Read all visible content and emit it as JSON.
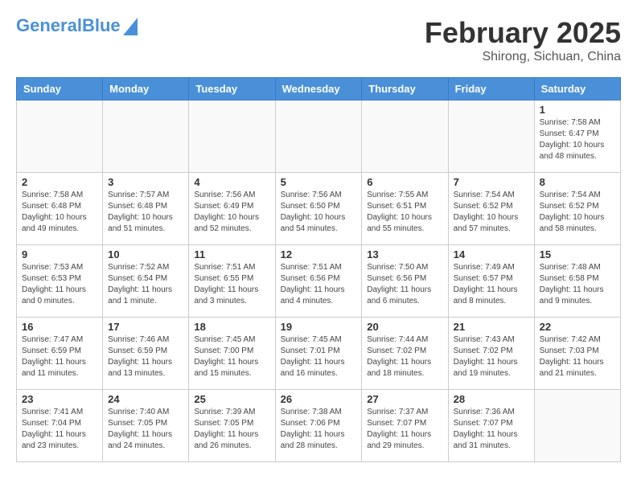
{
  "header": {
    "logo_line1": "General",
    "logo_line2": "Blue",
    "month_year": "February 2025",
    "location": "Shirong, Sichuan, China"
  },
  "weekdays": [
    "Sunday",
    "Monday",
    "Tuesday",
    "Wednesday",
    "Thursday",
    "Friday",
    "Saturday"
  ],
  "weeks": [
    [
      {
        "day": "",
        "info": ""
      },
      {
        "day": "",
        "info": ""
      },
      {
        "day": "",
        "info": ""
      },
      {
        "day": "",
        "info": ""
      },
      {
        "day": "",
        "info": ""
      },
      {
        "day": "",
        "info": ""
      },
      {
        "day": "1",
        "info": "Sunrise: 7:58 AM\nSunset: 6:47 PM\nDaylight: 10 hours\nand 48 minutes."
      }
    ],
    [
      {
        "day": "2",
        "info": "Sunrise: 7:58 AM\nSunset: 6:48 PM\nDaylight: 10 hours\nand 49 minutes."
      },
      {
        "day": "3",
        "info": "Sunrise: 7:57 AM\nSunset: 6:48 PM\nDaylight: 10 hours\nand 51 minutes."
      },
      {
        "day": "4",
        "info": "Sunrise: 7:56 AM\nSunset: 6:49 PM\nDaylight: 10 hours\nand 52 minutes."
      },
      {
        "day": "5",
        "info": "Sunrise: 7:56 AM\nSunset: 6:50 PM\nDaylight: 10 hours\nand 54 minutes."
      },
      {
        "day": "6",
        "info": "Sunrise: 7:55 AM\nSunset: 6:51 PM\nDaylight: 10 hours\nand 55 minutes."
      },
      {
        "day": "7",
        "info": "Sunrise: 7:54 AM\nSunset: 6:52 PM\nDaylight: 10 hours\nand 57 minutes."
      },
      {
        "day": "8",
        "info": "Sunrise: 7:54 AM\nSunset: 6:52 PM\nDaylight: 10 hours\nand 58 minutes."
      }
    ],
    [
      {
        "day": "9",
        "info": "Sunrise: 7:53 AM\nSunset: 6:53 PM\nDaylight: 11 hours\nand 0 minutes."
      },
      {
        "day": "10",
        "info": "Sunrise: 7:52 AM\nSunset: 6:54 PM\nDaylight: 11 hours\nand 1 minute."
      },
      {
        "day": "11",
        "info": "Sunrise: 7:51 AM\nSunset: 6:55 PM\nDaylight: 11 hours\nand 3 minutes."
      },
      {
        "day": "12",
        "info": "Sunrise: 7:51 AM\nSunset: 6:56 PM\nDaylight: 11 hours\nand 4 minutes."
      },
      {
        "day": "13",
        "info": "Sunrise: 7:50 AM\nSunset: 6:56 PM\nDaylight: 11 hours\nand 6 minutes."
      },
      {
        "day": "14",
        "info": "Sunrise: 7:49 AM\nSunset: 6:57 PM\nDaylight: 11 hours\nand 8 minutes."
      },
      {
        "day": "15",
        "info": "Sunrise: 7:48 AM\nSunset: 6:58 PM\nDaylight: 11 hours\nand 9 minutes."
      }
    ],
    [
      {
        "day": "16",
        "info": "Sunrise: 7:47 AM\nSunset: 6:59 PM\nDaylight: 11 hours\nand 11 minutes."
      },
      {
        "day": "17",
        "info": "Sunrise: 7:46 AM\nSunset: 6:59 PM\nDaylight: 11 hours\nand 13 minutes."
      },
      {
        "day": "18",
        "info": "Sunrise: 7:45 AM\nSunset: 7:00 PM\nDaylight: 11 hours\nand 15 minutes."
      },
      {
        "day": "19",
        "info": "Sunrise: 7:45 AM\nSunset: 7:01 PM\nDaylight: 11 hours\nand 16 minutes."
      },
      {
        "day": "20",
        "info": "Sunrise: 7:44 AM\nSunset: 7:02 PM\nDaylight: 11 hours\nand 18 minutes."
      },
      {
        "day": "21",
        "info": "Sunrise: 7:43 AM\nSunset: 7:02 PM\nDaylight: 11 hours\nand 19 minutes."
      },
      {
        "day": "22",
        "info": "Sunrise: 7:42 AM\nSunset: 7:03 PM\nDaylight: 11 hours\nand 21 minutes."
      }
    ],
    [
      {
        "day": "23",
        "info": "Sunrise: 7:41 AM\nSunset: 7:04 PM\nDaylight: 11 hours\nand 23 minutes."
      },
      {
        "day": "24",
        "info": "Sunrise: 7:40 AM\nSunset: 7:05 PM\nDaylight: 11 hours\nand 24 minutes."
      },
      {
        "day": "25",
        "info": "Sunrise: 7:39 AM\nSunset: 7:05 PM\nDaylight: 11 hours\nand 26 minutes."
      },
      {
        "day": "26",
        "info": "Sunrise: 7:38 AM\nSunset: 7:06 PM\nDaylight: 11 hours\nand 28 minutes."
      },
      {
        "day": "27",
        "info": "Sunrise: 7:37 AM\nSunset: 7:07 PM\nDaylight: 11 hours\nand 29 minutes."
      },
      {
        "day": "28",
        "info": "Sunrise: 7:36 AM\nSunset: 7:07 PM\nDaylight: 11 hours\nand 31 minutes."
      },
      {
        "day": "",
        "info": ""
      }
    ]
  ]
}
